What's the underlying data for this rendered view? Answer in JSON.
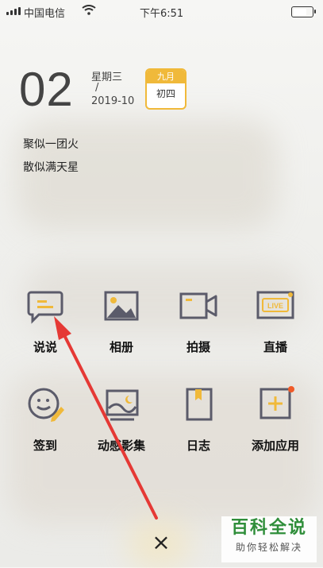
{
  "status_bar": {
    "carrier": "中国电信",
    "time": "下午6:51"
  },
  "date": {
    "day": "02",
    "weekday": "星期三",
    "separator": "/",
    "year_month": "2019-10",
    "lunar_month": "九月",
    "lunar_day": "初四"
  },
  "quote": {
    "line1": "聚似一团火",
    "line2": "散似满天星"
  },
  "actions": [
    {
      "label": "说说",
      "icon": "chat-icon"
    },
    {
      "label": "相册",
      "icon": "photo-album-icon"
    },
    {
      "label": "拍摄",
      "icon": "video-camera-icon"
    },
    {
      "label": "直播",
      "icon": "live-icon"
    },
    {
      "label": "签到",
      "icon": "check-in-icon"
    },
    {
      "label": "动感影集",
      "icon": "dynamic-album-icon"
    },
    {
      "label": "日志",
      "icon": "diary-icon"
    },
    {
      "label": "添加应用",
      "icon": "add-app-icon"
    }
  ],
  "close_label": "×",
  "watermark": {
    "title": "百科全说",
    "subtitle": "助你轻松解决"
  },
  "colors": {
    "accent": "#f0b93a",
    "icon_gray": "#5b5b6a",
    "badge": "#f05a28",
    "arrow": "#e53935"
  }
}
